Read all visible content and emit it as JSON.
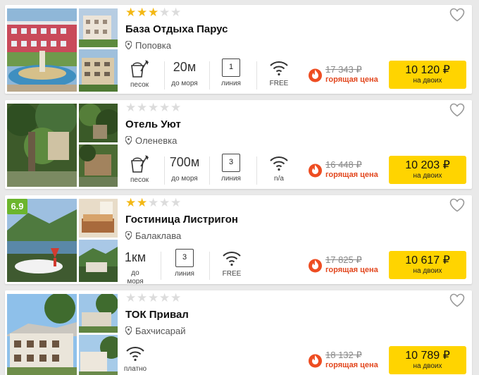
{
  "hotels": [
    {
      "name": "База Отдыха Парус",
      "location": "Поповка",
      "stars": 3,
      "rating_badge": "",
      "amenities": {
        "beach_label": "песок",
        "distance_value": "20м",
        "distance_label": "до моря",
        "line_value": "1",
        "line_label": "линия",
        "wifi_label": "FREE"
      },
      "old_price": "17 343 ₽",
      "hot_label": "горящая цена",
      "price": "10 120 ₽",
      "price_note": "на двоих"
    },
    {
      "name": "Отель Уют",
      "location": "Оленевка",
      "stars": 0,
      "rating_badge": "",
      "amenities": {
        "beach_label": "песок",
        "distance_value": "700м",
        "distance_label": "до моря",
        "line_value": "3",
        "line_label": "линия",
        "wifi_label": "n/a"
      },
      "old_price": "16 448 ₽",
      "hot_label": "горящая цена",
      "price": "10 203 ₽",
      "price_note": "на двоих"
    },
    {
      "name": "Гостиница Листригон",
      "location": "Балаклава",
      "stars": 2,
      "rating_badge": "6.9",
      "amenities": {
        "distance_value": "1км",
        "distance_label": "до моря",
        "line_value": "3",
        "line_label": "линия",
        "wifi_label": "FREE"
      },
      "old_price": "17 825 ₽",
      "hot_label": "горящая цена",
      "price": "10 617 ₽",
      "price_note": "на двоих"
    },
    {
      "name": "ТОК Привал",
      "location": "Бахчисарай",
      "stars": 0,
      "rating_badge": "",
      "amenities": {
        "wifi_label": "платно"
      },
      "old_price": "18 132 ₽",
      "hot_label": "горящая цена",
      "price": "10 789 ₽",
      "price_note": "на двоих"
    }
  ],
  "icons": {
    "star": "star-icon",
    "heart": "heart-outline-icon",
    "pin": "map-pin-icon",
    "beach": "beach-bucket-icon",
    "wifi": "wifi-icon",
    "fire": "fire-icon"
  },
  "colors": {
    "star_on": "#f3b815",
    "star_off": "#dcdcdc",
    "price_button": "#ffd400",
    "hot": "#e2461d",
    "rating_badge": "#6cb52d"
  }
}
